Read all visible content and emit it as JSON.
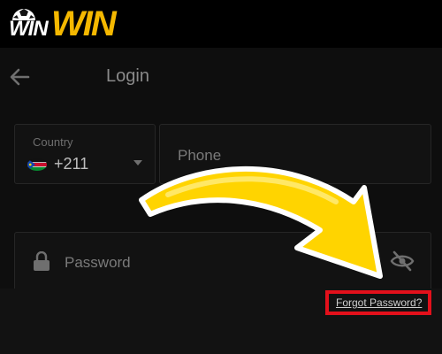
{
  "brand": {
    "part1": "WIN",
    "part2": "WIN"
  },
  "header": {
    "title": "Login"
  },
  "country": {
    "label": "Country",
    "code": "+211"
  },
  "phone": {
    "placeholder": "Phone"
  },
  "password": {
    "placeholder": "Password"
  },
  "links": {
    "forgot_password": "Forgot Password?"
  },
  "icons": {
    "back": "arrow-left-icon",
    "caret": "chevron-down-icon",
    "lock": "lock-icon",
    "visibility": "eye-off-icon",
    "flag": "south-sudan-flag-icon"
  },
  "colors": {
    "brand_gold": "#f5b800",
    "annotation_red": "#e3101b",
    "arrow_yellow": "#ffd400",
    "background": "#0e0e0e"
  }
}
